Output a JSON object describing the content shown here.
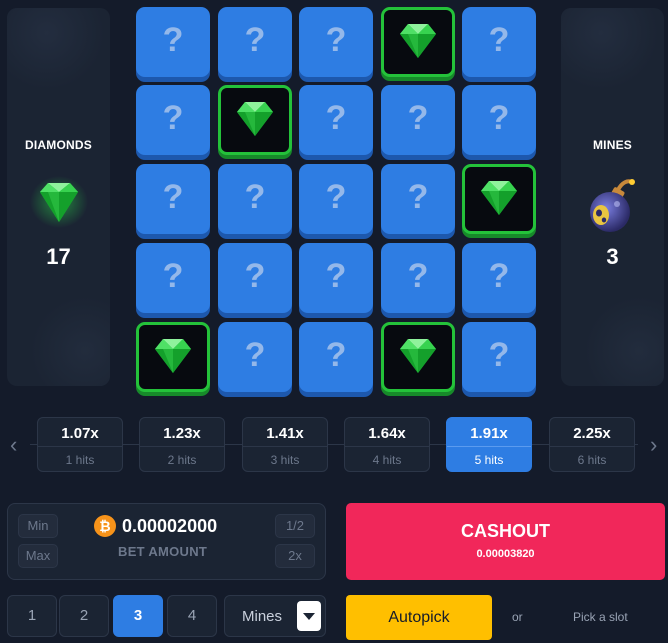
{
  "diamonds_panel": {
    "title": "DIAMONDS",
    "count": "17",
    "icon": "diamond-icon"
  },
  "mines_panel": {
    "title": "MINES",
    "count": "3",
    "icon": "bomb-icon"
  },
  "grid": {
    "rows": 5,
    "cols": 5,
    "hidden_symbol": "?",
    "cells": [
      [
        "hidden",
        "hidden",
        "hidden",
        "diamond",
        "hidden"
      ],
      [
        "hidden",
        "diamond",
        "hidden",
        "hidden",
        "hidden"
      ],
      [
        "hidden",
        "hidden",
        "hidden",
        "hidden",
        "diamond"
      ],
      [
        "hidden",
        "hidden",
        "hidden",
        "hidden",
        "hidden"
      ],
      [
        "diamond",
        "hidden",
        "hidden",
        "diamond",
        "hidden"
      ]
    ]
  },
  "multipliers": [
    {
      "value": "1.07x",
      "hits": "1 hits",
      "active": false
    },
    {
      "value": "1.23x",
      "hits": "2 hits",
      "active": false
    },
    {
      "value": "1.41x",
      "hits": "3 hits",
      "active": false
    },
    {
      "value": "1.64x",
      "hits": "4 hits",
      "active": false
    },
    {
      "value": "1.91x",
      "hits": "5 hits",
      "active": true
    },
    {
      "value": "2.25x",
      "hits": "6 hits",
      "active": false
    }
  ],
  "multiplier_nav": {
    "prev": "‹",
    "next": "›"
  },
  "bet": {
    "min_label": "Min",
    "max_label": "Max",
    "amount": "0.00002000",
    "label": "BET AMOUNT",
    "half_label": "1/2",
    "double_label": "2x",
    "currency_symbol": "₿"
  },
  "cashout": {
    "label": "CASHOUT",
    "amount": "0.00003820"
  },
  "mine_options": [
    "1",
    "2",
    "3",
    "4"
  ],
  "selected_mines": "3",
  "mines_select_label": "Mines",
  "autopick_label": "Autopick",
  "or_label": "or",
  "pick_slot_label": "Pick a slot",
  "colors": {
    "background": "#141b2a",
    "tile_blue": "#2e7de3",
    "diamond_green": "#24c23a",
    "cashout_red": "#f1275a",
    "autopick_yellow": "#ffbf00"
  }
}
